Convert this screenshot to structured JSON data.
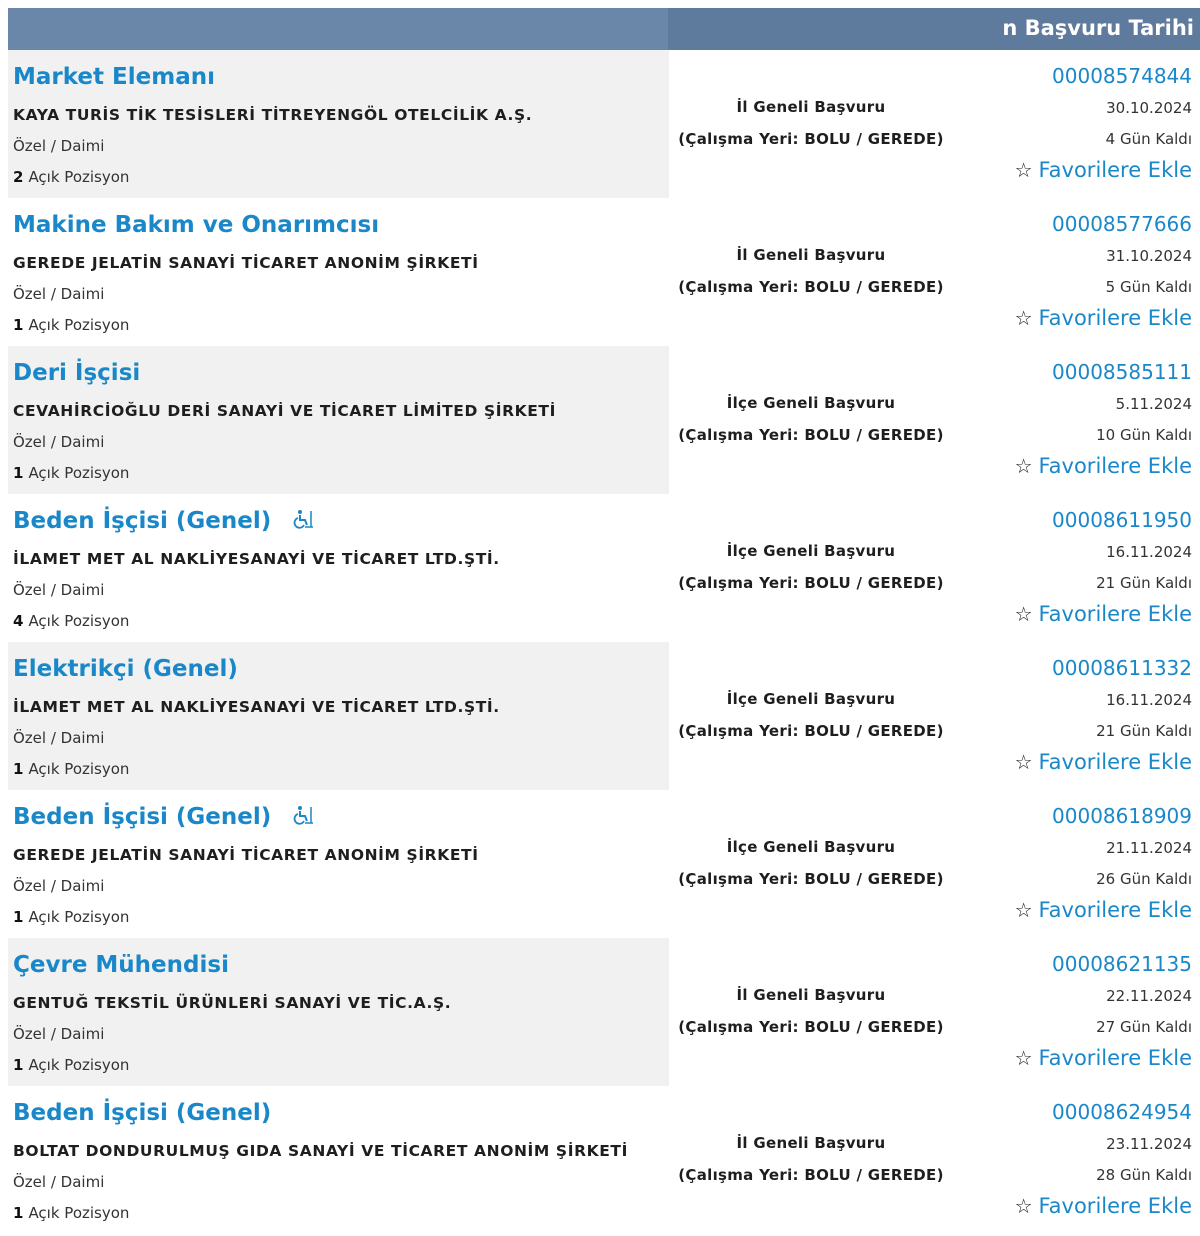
{
  "header": {
    "title": "n Başvuru Tarihi"
  },
  "labels": {
    "workplace_prefix": "(Çalışma Yeri: ",
    "workplace_suffix": ")",
    "positions_suffix": "Açık Pozisyon",
    "favorite": "Favorilere Ekle"
  },
  "rows": [
    {
      "title": "Market Elemanı",
      "accessible": false,
      "company": "KAYA TURİS TİK TESİSLERİ TİTREYENGÖL OTELCİLİK A.Ş.",
      "employment": "Özel / Daimi",
      "positions": "2",
      "scope": "İl Geneli Başvuru",
      "workplace": "(Çalışma Yeri: BOLU / GEREDE)",
      "ilan_no": "00008574844",
      "date": "30.10.2024",
      "days_left": "4 Gün Kaldı",
      "favorite": "Favorilere Ekle"
    },
    {
      "title": "Makine Bakım ve Onarımcısı",
      "accessible": false,
      "company": "GEREDE JELATİN SANAYİ TİCARET ANONİM ŞİRKETİ",
      "employment": "Özel / Daimi",
      "positions": "1",
      "scope": "İl Geneli Başvuru",
      "workplace": "(Çalışma Yeri: BOLU / GEREDE)",
      "ilan_no": "00008577666",
      "date": "31.10.2024",
      "days_left": "5 Gün Kaldı",
      "favorite": "Favorilere Ekle"
    },
    {
      "title": "Deri İşçisi",
      "accessible": false,
      "company": "CEVAHİRCİOĞLU DERİ SANAYİ VE TİCARET LİMİTED ŞİRKETİ",
      "employment": "Özel / Daimi",
      "positions": "1",
      "scope": "İlçe Geneli Başvuru",
      "workplace": "(Çalışma Yeri: BOLU / GEREDE)",
      "ilan_no": "00008585111",
      "date": "5.11.2024",
      "days_left": "10 Gün Kaldı",
      "favorite": "Favorilere Ekle"
    },
    {
      "title": "Beden İşçisi (Genel)",
      "accessible": true,
      "company": "İLAMET MET AL NAKLİYESANAYİ VE TİCARET LTD.ŞTİ.",
      "employment": "Özel / Daimi",
      "positions": "4",
      "scope": "İlçe Geneli Başvuru",
      "workplace": "(Çalışma Yeri: BOLU / GEREDE)",
      "ilan_no": "00008611950",
      "date": "16.11.2024",
      "days_left": "21 Gün Kaldı",
      "favorite": "Favorilere Ekle"
    },
    {
      "title": "Elektrikçi (Genel)",
      "accessible": false,
      "company": "İLAMET MET AL NAKLİYESANAYİ VE TİCARET LTD.ŞTİ.",
      "employment": "Özel / Daimi",
      "positions": "1",
      "scope": "İlçe Geneli Başvuru",
      "workplace": "(Çalışma Yeri: BOLU / GEREDE)",
      "ilan_no": "00008611332",
      "date": "16.11.2024",
      "days_left": "21 Gün Kaldı",
      "favorite": "Favorilere Ekle"
    },
    {
      "title": "Beden İşçisi (Genel)",
      "accessible": true,
      "company": "GEREDE JELATİN SANAYİ TİCARET ANONİM ŞİRKETİ",
      "employment": "Özel / Daimi",
      "positions": "1",
      "scope": "İlçe Geneli Başvuru",
      "workplace": "(Çalışma Yeri: BOLU / GEREDE)",
      "ilan_no": "00008618909",
      "date": "21.11.2024",
      "days_left": "26 Gün Kaldı",
      "favorite": "Favorilere Ekle"
    },
    {
      "title": "Çevre Mühendisi",
      "accessible": false,
      "company": "GENTUĞ TEKSTİL ÜRÜNLERİ SANAYİ VE TİC.A.Ş.",
      "employment": "Özel / Daimi",
      "positions": "1",
      "scope": "İl Geneli Başvuru",
      "workplace": "(Çalışma Yeri: BOLU / GEREDE)",
      "ilan_no": "00008621135",
      "date": "22.11.2024",
      "days_left": "27 Gün Kaldı",
      "favorite": "Favorilere Ekle"
    },
    {
      "title": "Beden İşçisi (Genel)",
      "accessible": false,
      "company": "BOLTAT DONDURULMUŞ GIDA SANAYİ VE TİCARET ANONİM ŞİRKETİ",
      "employment": "Özel / Daimi",
      "positions": "1",
      "scope": "İl Geneli Başvuru",
      "workplace": "(Çalışma Yeri: BOLU / GEREDE)",
      "ilan_no": "00008624954",
      "date": "23.11.2024",
      "days_left": "28 Gün Kaldı",
      "favorite": "Favorilere Ekle"
    }
  ],
  "icons": {
    "favorite": "star-outline-icon",
    "accessible": "wheelchair-icon"
  },
  "colors": {
    "header": "#5e7a9c",
    "link": "#1a87c9",
    "row_shade": "#f1f1f1"
  }
}
